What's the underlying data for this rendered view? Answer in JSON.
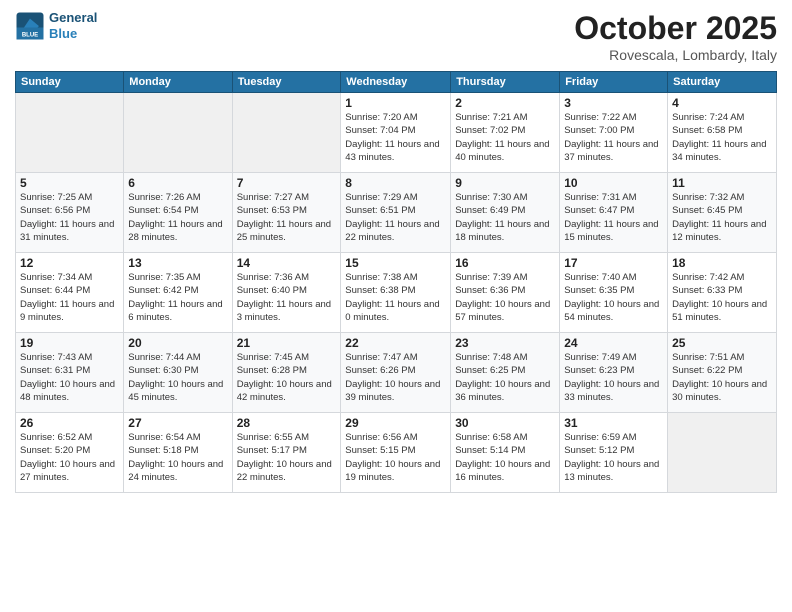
{
  "logo": {
    "line1": "General",
    "line2": "Blue"
  },
  "title": "October 2025",
  "location": "Rovescala, Lombardy, Italy",
  "days_of_week": [
    "Sunday",
    "Monday",
    "Tuesday",
    "Wednesday",
    "Thursday",
    "Friday",
    "Saturday"
  ],
  "weeks": [
    [
      {
        "day": "",
        "info": ""
      },
      {
        "day": "",
        "info": ""
      },
      {
        "day": "",
        "info": ""
      },
      {
        "day": "1",
        "info": "Sunrise: 7:20 AM\nSunset: 7:04 PM\nDaylight: 11 hours\nand 43 minutes."
      },
      {
        "day": "2",
        "info": "Sunrise: 7:21 AM\nSunset: 7:02 PM\nDaylight: 11 hours\nand 40 minutes."
      },
      {
        "day": "3",
        "info": "Sunrise: 7:22 AM\nSunset: 7:00 PM\nDaylight: 11 hours\nand 37 minutes."
      },
      {
        "day": "4",
        "info": "Sunrise: 7:24 AM\nSunset: 6:58 PM\nDaylight: 11 hours\nand 34 minutes."
      }
    ],
    [
      {
        "day": "5",
        "info": "Sunrise: 7:25 AM\nSunset: 6:56 PM\nDaylight: 11 hours\nand 31 minutes."
      },
      {
        "day": "6",
        "info": "Sunrise: 7:26 AM\nSunset: 6:54 PM\nDaylight: 11 hours\nand 28 minutes."
      },
      {
        "day": "7",
        "info": "Sunrise: 7:27 AM\nSunset: 6:53 PM\nDaylight: 11 hours\nand 25 minutes."
      },
      {
        "day": "8",
        "info": "Sunrise: 7:29 AM\nSunset: 6:51 PM\nDaylight: 11 hours\nand 22 minutes."
      },
      {
        "day": "9",
        "info": "Sunrise: 7:30 AM\nSunset: 6:49 PM\nDaylight: 11 hours\nand 18 minutes."
      },
      {
        "day": "10",
        "info": "Sunrise: 7:31 AM\nSunset: 6:47 PM\nDaylight: 11 hours\nand 15 minutes."
      },
      {
        "day": "11",
        "info": "Sunrise: 7:32 AM\nSunset: 6:45 PM\nDaylight: 11 hours\nand 12 minutes."
      }
    ],
    [
      {
        "day": "12",
        "info": "Sunrise: 7:34 AM\nSunset: 6:44 PM\nDaylight: 11 hours\nand 9 minutes."
      },
      {
        "day": "13",
        "info": "Sunrise: 7:35 AM\nSunset: 6:42 PM\nDaylight: 11 hours\nand 6 minutes."
      },
      {
        "day": "14",
        "info": "Sunrise: 7:36 AM\nSunset: 6:40 PM\nDaylight: 11 hours\nand 3 minutes."
      },
      {
        "day": "15",
        "info": "Sunrise: 7:38 AM\nSunset: 6:38 PM\nDaylight: 11 hours\nand 0 minutes."
      },
      {
        "day": "16",
        "info": "Sunrise: 7:39 AM\nSunset: 6:36 PM\nDaylight: 10 hours\nand 57 minutes."
      },
      {
        "day": "17",
        "info": "Sunrise: 7:40 AM\nSunset: 6:35 PM\nDaylight: 10 hours\nand 54 minutes."
      },
      {
        "day": "18",
        "info": "Sunrise: 7:42 AM\nSunset: 6:33 PM\nDaylight: 10 hours\nand 51 minutes."
      }
    ],
    [
      {
        "day": "19",
        "info": "Sunrise: 7:43 AM\nSunset: 6:31 PM\nDaylight: 10 hours\nand 48 minutes."
      },
      {
        "day": "20",
        "info": "Sunrise: 7:44 AM\nSunset: 6:30 PM\nDaylight: 10 hours\nand 45 minutes."
      },
      {
        "day": "21",
        "info": "Sunrise: 7:45 AM\nSunset: 6:28 PM\nDaylight: 10 hours\nand 42 minutes."
      },
      {
        "day": "22",
        "info": "Sunrise: 7:47 AM\nSunset: 6:26 PM\nDaylight: 10 hours\nand 39 minutes."
      },
      {
        "day": "23",
        "info": "Sunrise: 7:48 AM\nSunset: 6:25 PM\nDaylight: 10 hours\nand 36 minutes."
      },
      {
        "day": "24",
        "info": "Sunrise: 7:49 AM\nSunset: 6:23 PM\nDaylight: 10 hours\nand 33 minutes."
      },
      {
        "day": "25",
        "info": "Sunrise: 7:51 AM\nSunset: 6:22 PM\nDaylight: 10 hours\nand 30 minutes."
      }
    ],
    [
      {
        "day": "26",
        "info": "Sunrise: 6:52 AM\nSunset: 5:20 PM\nDaylight: 10 hours\nand 27 minutes."
      },
      {
        "day": "27",
        "info": "Sunrise: 6:54 AM\nSunset: 5:18 PM\nDaylight: 10 hours\nand 24 minutes."
      },
      {
        "day": "28",
        "info": "Sunrise: 6:55 AM\nSunset: 5:17 PM\nDaylight: 10 hours\nand 22 minutes."
      },
      {
        "day": "29",
        "info": "Sunrise: 6:56 AM\nSunset: 5:15 PM\nDaylight: 10 hours\nand 19 minutes."
      },
      {
        "day": "30",
        "info": "Sunrise: 6:58 AM\nSunset: 5:14 PM\nDaylight: 10 hours\nand 16 minutes."
      },
      {
        "day": "31",
        "info": "Sunrise: 6:59 AM\nSunset: 5:12 PM\nDaylight: 10 hours\nand 13 minutes."
      },
      {
        "day": "",
        "info": ""
      }
    ]
  ]
}
